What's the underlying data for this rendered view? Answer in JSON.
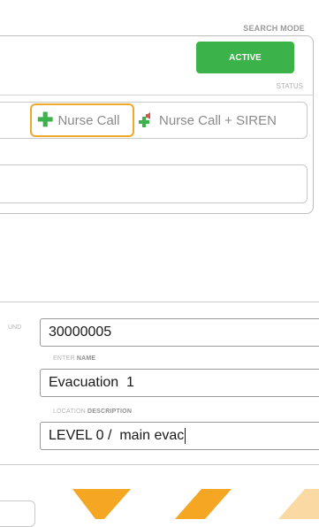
{
  "header": {
    "search_mode_label": "SEARCH MODE"
  },
  "status": {
    "active_label": "ACTIVE",
    "status_label": "STATUS"
  },
  "call_options": {
    "nurse_call_label": "Nurse Call",
    "nurse_call_siren_label": "Nurse Call + SIREN"
  },
  "form": {
    "clipped_label": "UND",
    "number_value": "30000005",
    "name_caption_prefix": "ENTER",
    "name_caption_bold": "NAME",
    "name_value": "Evacuation  1",
    "location_caption_prefix": "LOCATION",
    "location_caption_bold": "DESCRIPTION",
    "location_value": "LEVEL 0 /  main evac"
  },
  "colors": {
    "active_green": "#3cb34a",
    "selection_orange": "#f0a82a",
    "siren_red": "#d9534f"
  },
  "icons": [
    "plus-icon",
    "plus-siren-icon"
  ]
}
